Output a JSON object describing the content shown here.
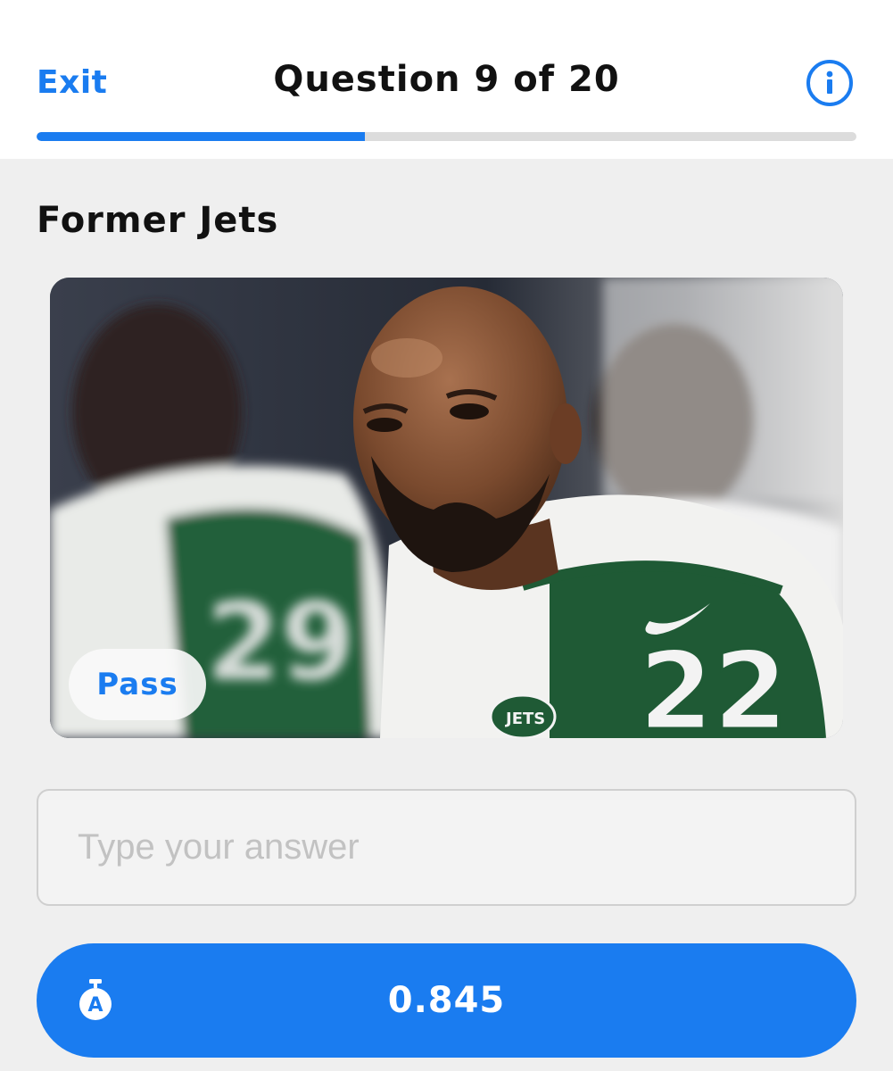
{
  "header": {
    "exit_label": "Exit",
    "title": "Question 9 of 20",
    "info_icon": "info-icon"
  },
  "progress": {
    "fraction": 0.4
  },
  "question": {
    "category": "Former Jets",
    "image": {
      "jersey_numbers": [
        "29",
        "22"
      ],
      "logo_text": "JETS"
    },
    "pass_label": "Pass"
  },
  "answer": {
    "placeholder": "Type your answer",
    "value": ""
  },
  "submit": {
    "timer_icon": "stopwatch-icon",
    "timer_icon_letter": "A",
    "timer_value": "0.845"
  },
  "colors": {
    "accent": "#1a7cf0",
    "jersey_green": "#1f5a35",
    "background": "#efefef"
  }
}
